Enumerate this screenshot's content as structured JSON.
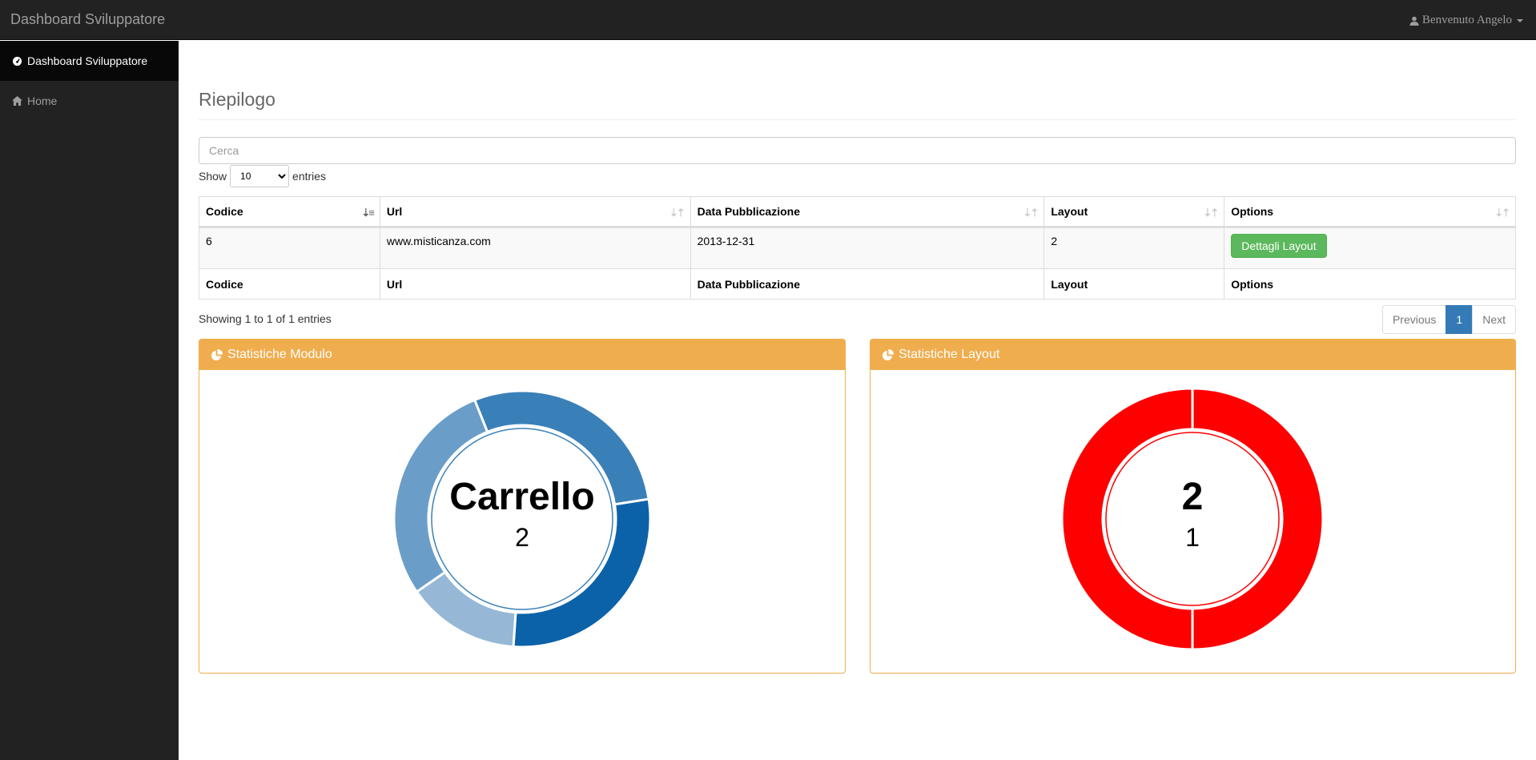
{
  "navbar": {
    "brand": "Dashboard Sviluppatore",
    "user": "Benvenuto Angelo"
  },
  "sidebar": {
    "items": [
      {
        "label": "Dashboard Sviluppatore",
        "icon": "dashboard-icon"
      },
      {
        "label": "Home",
        "icon": "home-icon"
      }
    ]
  },
  "main": {
    "title": "Riepilogo",
    "search": {
      "placeholder": "Cerca"
    },
    "length": {
      "before": "Show",
      "value": "10",
      "after": "entries"
    },
    "table": {
      "columns": [
        "Codice",
        "Url",
        "Data Pubblicazione",
        "Layout",
        "Options"
      ],
      "rows": [
        {
          "codice": "6",
          "url": "www.misticanza.com",
          "data": "2013-12-31",
          "layout": "2",
          "button": "Dettagli Layout"
        }
      ]
    },
    "info": "Showing 1 to 1 of 1 entries",
    "pagination": {
      "previous": "Previous",
      "page": "1",
      "next": "Next"
    }
  },
  "panels": [
    {
      "title": "Statistiche Modulo",
      "center_label": "Carrello",
      "center_value": "2"
    },
    {
      "title": "Statistiche Layout",
      "center_label": "2",
      "center_value": "1"
    }
  ],
  "chart_data": [
    {
      "type": "pie",
      "title": "Statistiche Modulo",
      "series": [
        {
          "values": [
            2,
            2,
            1,
            2
          ]
        }
      ],
      "colors": [
        "#3a80b8",
        "#0b62a8",
        "#96b8d6",
        "#6a9ec9"
      ]
    },
    {
      "type": "pie",
      "title": "Statistiche Layout",
      "series": [
        {
          "values": [
            1,
            1
          ]
        }
      ],
      "colors": [
        "#ff0000",
        "#ff0000"
      ]
    }
  ]
}
